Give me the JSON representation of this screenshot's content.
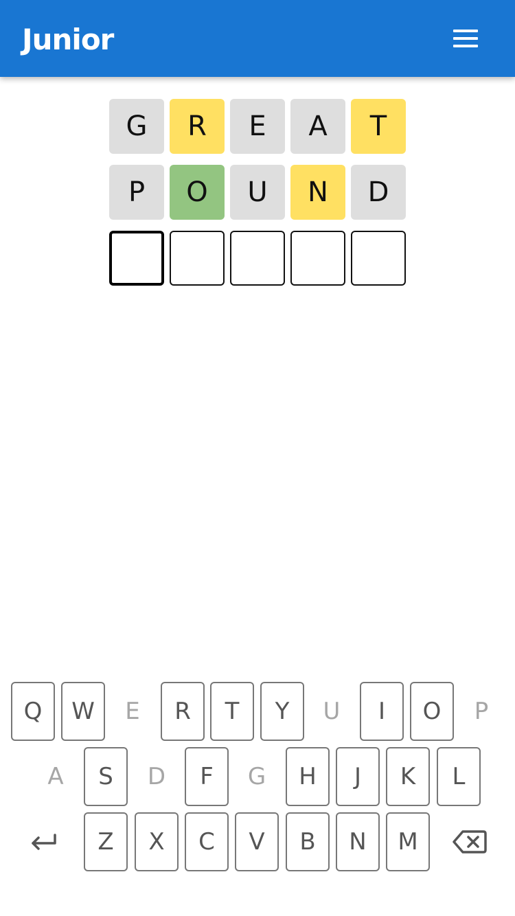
{
  "header": {
    "logo_text": "Junior",
    "menu_icon": "hamburger-menu-icon",
    "background_color": "#1976d2"
  },
  "board": {
    "rows": [
      {
        "letters": [
          "G",
          "R",
          "E",
          "A",
          "T"
        ],
        "states": [
          "absent",
          "present",
          "absent",
          "absent",
          "present"
        ]
      },
      {
        "letters": [
          "P",
          "O",
          "U",
          "N",
          "D"
        ],
        "states": [
          "absent",
          "correct",
          "absent",
          "present",
          "absent"
        ]
      },
      {
        "letters": [
          "",
          "",
          "",
          "",
          ""
        ],
        "states": [
          "active",
          "empty",
          "empty",
          "empty",
          "empty"
        ]
      }
    ],
    "colors": {
      "absent": "#dedede",
      "present": "#ffe062",
      "correct": "#93c581"
    }
  },
  "keyboard": {
    "row1": [
      {
        "label": "Q",
        "disabled": false
      },
      {
        "label": "W",
        "disabled": false
      },
      {
        "label": "E",
        "disabled": true
      },
      {
        "label": "R",
        "disabled": false
      },
      {
        "label": "T",
        "disabled": false
      },
      {
        "label": "Y",
        "disabled": false
      },
      {
        "label": "U",
        "disabled": true
      },
      {
        "label": "I",
        "disabled": false
      },
      {
        "label": "O",
        "disabled": false
      },
      {
        "label": "P",
        "disabled": true
      }
    ],
    "row2": [
      {
        "label": "A",
        "disabled": true
      },
      {
        "label": "S",
        "disabled": false
      },
      {
        "label": "D",
        "disabled": true
      },
      {
        "label": "F",
        "disabled": false
      },
      {
        "label": "G",
        "disabled": true
      },
      {
        "label": "H",
        "disabled": false
      },
      {
        "label": "J",
        "disabled": false
      },
      {
        "label": "K",
        "disabled": false
      },
      {
        "label": "L",
        "disabled": false
      }
    ],
    "row3": [
      {
        "label": "Z",
        "disabled": false
      },
      {
        "label": "X",
        "disabled": false
      },
      {
        "label": "C",
        "disabled": false
      },
      {
        "label": "V",
        "disabled": false
      },
      {
        "label": "B",
        "disabled": false
      },
      {
        "label": "N",
        "disabled": false
      },
      {
        "label": "M",
        "disabled": false
      }
    ],
    "enter_icon": "enter-return-icon",
    "backspace_icon": "backspace-icon"
  }
}
